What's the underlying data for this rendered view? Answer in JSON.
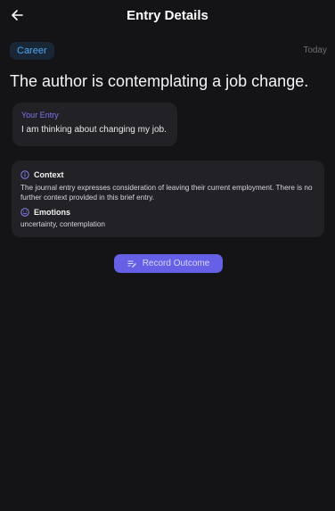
{
  "header": {
    "title": "Entry Details",
    "back_icon": "arrow-left-icon"
  },
  "entry": {
    "category": "Career",
    "date": "Today",
    "summary": "The author is contemplating a job change.",
    "your_entry_label": "Your Entry",
    "your_entry_text": "I am thinking about changing my job."
  },
  "analysis": {
    "context_title": "Context",
    "context_icon": "info-icon",
    "context_text": "The journal entry expresses consideration of leaving their current employment. There is no further context provided in this brief entry.",
    "emotions_title": "Emotions",
    "emotions_icon": "smile-icon",
    "emotions_text": "uncertainty, contemplation"
  },
  "actions": {
    "record_outcome_label": "Record Outcome",
    "record_outcome_icon": "edit-note-icon"
  },
  "colors": {
    "background": "#141417",
    "card": "#222226",
    "accent": "#6660e6",
    "category_text": "#52a6f3",
    "category_bg": "#182635"
  }
}
